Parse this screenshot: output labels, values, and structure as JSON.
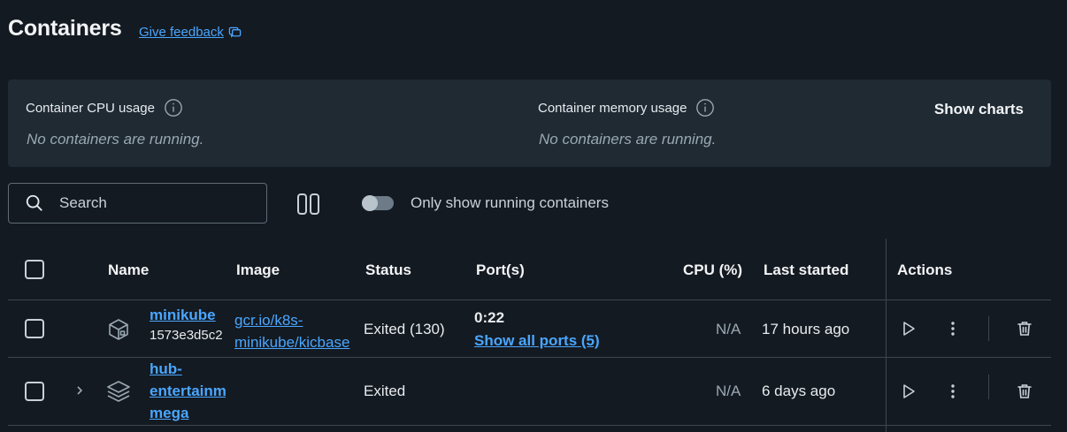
{
  "header": {
    "title": "Containers",
    "feedback_label": "Give feedback"
  },
  "stats": {
    "cpu_label": "Container CPU usage",
    "cpu_empty": "No containers are running.",
    "memory_label": "Container memory usage",
    "memory_empty": "No containers are running.",
    "show_charts": "Show charts"
  },
  "toolbar": {
    "search_placeholder": "Search",
    "toggle_label": "Only show running containers",
    "toggle_on": false
  },
  "table": {
    "columns": {
      "name": "Name",
      "image": "Image",
      "status": "Status",
      "ports": "Port(s)",
      "cpu": "CPU (%)",
      "last_started": "Last started",
      "actions": "Actions"
    },
    "rows": [
      {
        "name": "minikube",
        "id": "1573e3d5c2",
        "image_line1": "gcr.io/k8s-",
        "image_line2": "minikube/kicbase",
        "status": "Exited (130)",
        "port": "0:22",
        "ports_link": "Show all ports (5)",
        "cpu": "N/A",
        "last_started": "17 hours ago",
        "icon": "container-cube-icon"
      },
      {
        "name_line1": "hub-",
        "name_line2": "entertainment",
        "name_line3": "mega",
        "status": "Exited",
        "cpu": "N/A",
        "last_started": "6 days ago",
        "icon": "stack-layers-icon"
      }
    ]
  },
  "colors": {
    "background": "#141a21",
    "panel": "#1f2a33",
    "link": "#4aa6ff"
  }
}
